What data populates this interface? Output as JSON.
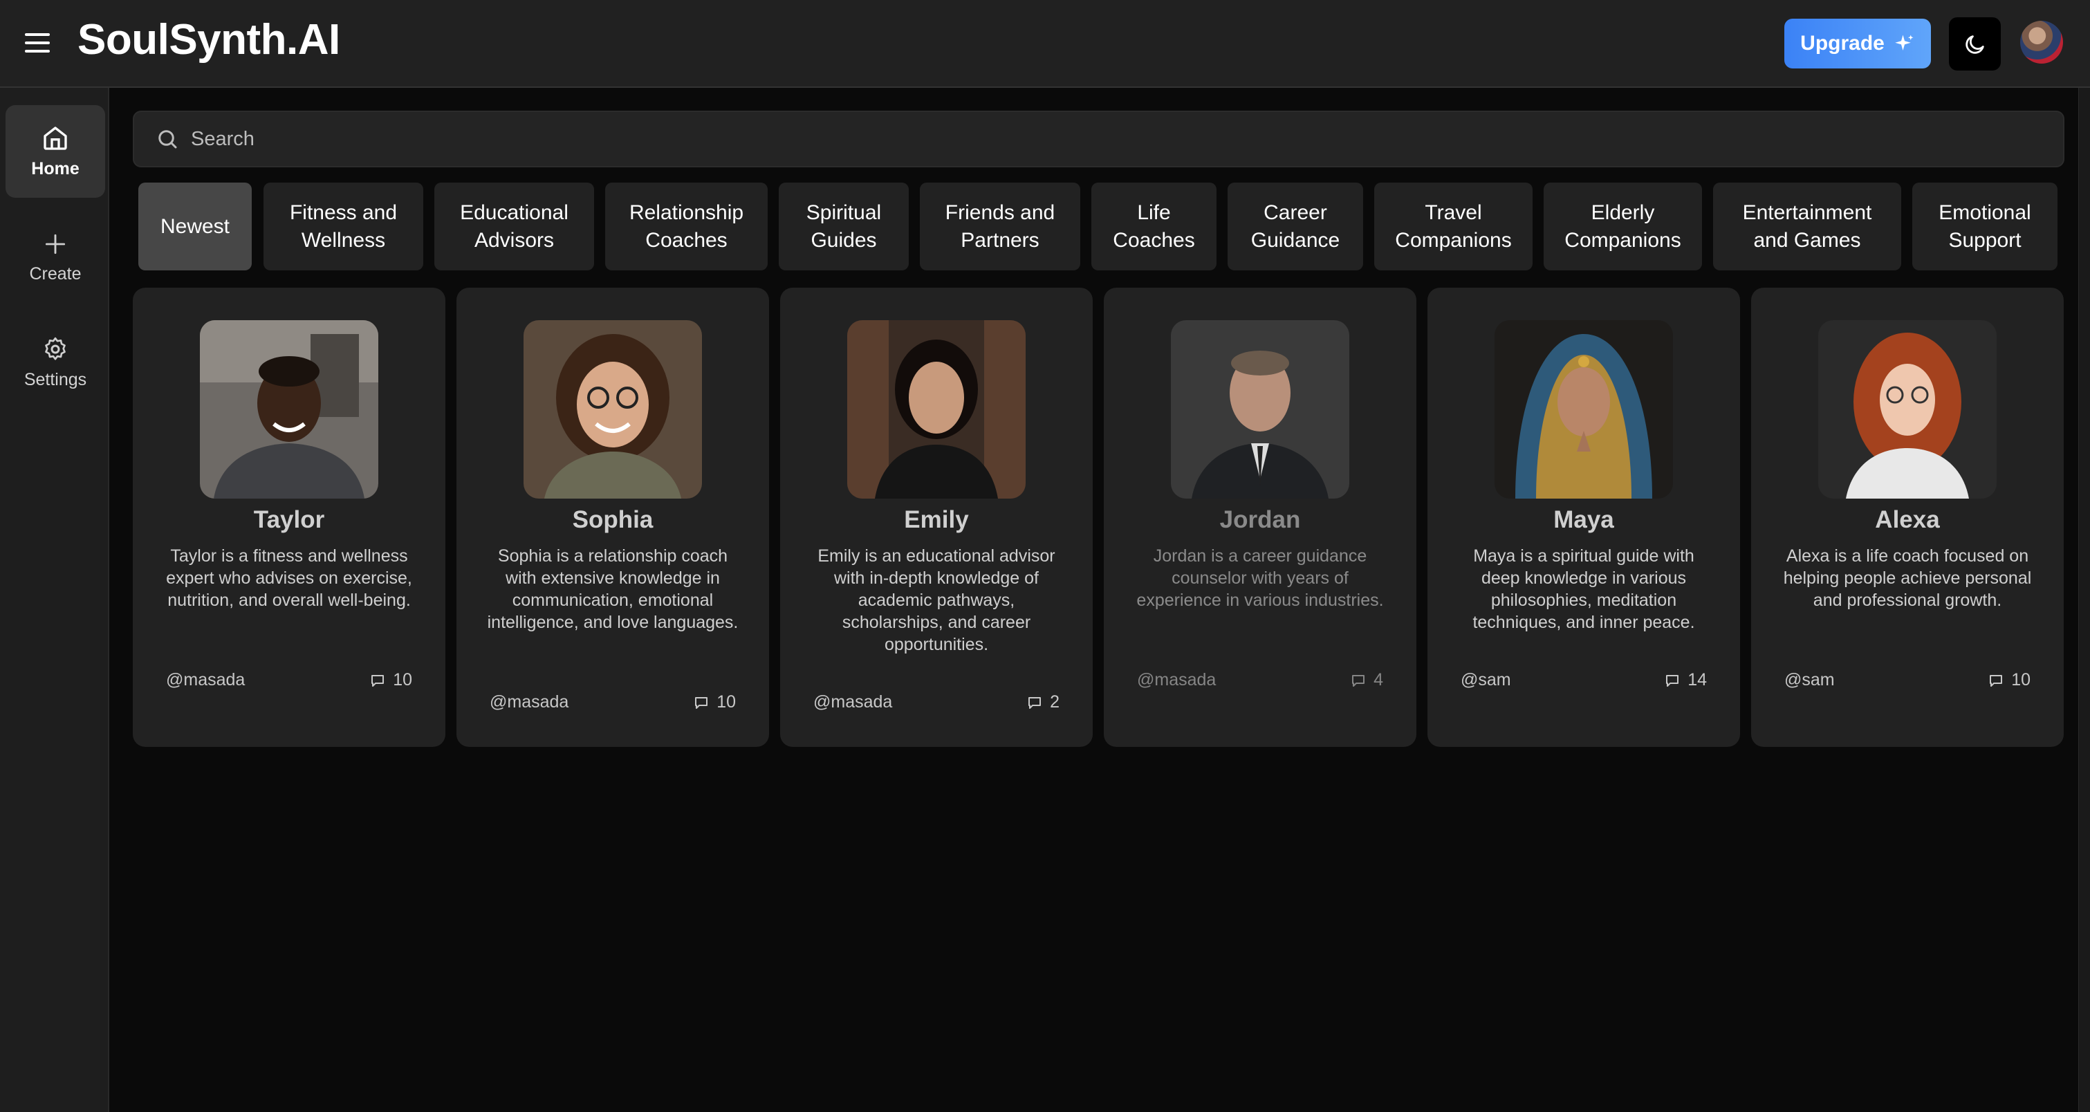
{
  "app": {
    "brand": "SoulSynth.AI"
  },
  "header": {
    "upgrade_label": "Upgrade"
  },
  "sidebar": {
    "items": [
      {
        "label": "Home",
        "icon": "home-icon"
      },
      {
        "label": "Create",
        "icon": "plus-icon"
      },
      {
        "label": "Settings",
        "icon": "gear-icon"
      }
    ]
  },
  "search": {
    "placeholder": "Search"
  },
  "categories": [
    "Newest",
    "Fitness and\nWellness",
    "Educational\nAdvisors",
    "Relationship\nCoaches",
    "Spiritual\nGuides",
    "Friends and\nPartners",
    "Life\nCoaches",
    "Career\nGuidance",
    "Travel\nCompanions",
    "Elderly\nCompanions",
    "Entertainment\nand Games",
    "Emotional\nSupport"
  ],
  "characters": [
    {
      "name": "Taylor",
      "description": "Taylor is a fitness and wellness expert who advises on exercise, nutrition, and overall well-being.",
      "author": "@masada",
      "messages": "10"
    },
    {
      "name": "Sophia",
      "description": "Sophia is a relationship coach with extensive knowledge in communication, emotional intelligence, and love languages.",
      "author": "@masada",
      "messages": "10"
    },
    {
      "name": "Emily",
      "description": "Emily is an educational advisor with in-depth knowledge of academic pathways, scholarships, and career opportunities.",
      "author": "@masada",
      "messages": "2"
    },
    {
      "name": "Jordan",
      "description": "Jordan is a career guidance counselor with years of experience in various industries.",
      "author": "@masada",
      "messages": "4"
    },
    {
      "name": "Maya",
      "description": "Maya is a spiritual guide with deep knowledge in various philosophies, meditation techniques, and inner peace.",
      "author": "@sam",
      "messages": "14"
    },
    {
      "name": "Alexa",
      "description": "Alexa is a life coach focused on helping people achieve personal and professional growth.",
      "author": "@sam",
      "messages": "10"
    }
  ],
  "colors": {
    "accent": "#3b82f6",
    "background": "#0a0a0a",
    "panel": "#222222"
  }
}
